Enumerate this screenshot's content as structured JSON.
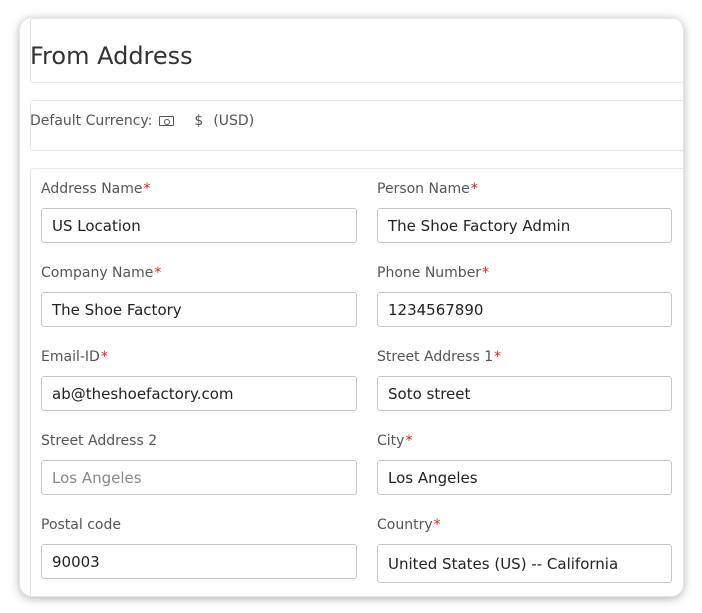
{
  "header": {
    "title": "From Address"
  },
  "currency": {
    "label": "Default Currency:",
    "symbol": "$",
    "code": "(USD)",
    "icon": "money-icon"
  },
  "form": {
    "required_marker": "*",
    "address_name": {
      "label": "Address Name",
      "value": "US Location"
    },
    "person_name": {
      "label": "Person Name",
      "value": "The Shoe Factory Admin"
    },
    "company_name": {
      "label": "Company Name",
      "value": "The Shoe Factory"
    },
    "phone_number": {
      "label": "Phone Number",
      "value": "1234567890"
    },
    "email_id": {
      "label": "Email-ID",
      "value": "ab@theshoefactory.com"
    },
    "street_address_1": {
      "label": "Street Address 1",
      "value": "Soto street"
    },
    "street_address_2": {
      "label": "Street Address 2",
      "value": "",
      "placeholder": "Los Angeles"
    },
    "city": {
      "label": "City",
      "value": "Los Angeles"
    },
    "postal_code": {
      "label": "Postal code",
      "value": "90003"
    },
    "country": {
      "label": "Country",
      "value": "United States (US) -- California"
    }
  },
  "colors": {
    "required": "#e02020",
    "border": "#c8c8c8",
    "label": "#555555",
    "text": "#222222"
  }
}
